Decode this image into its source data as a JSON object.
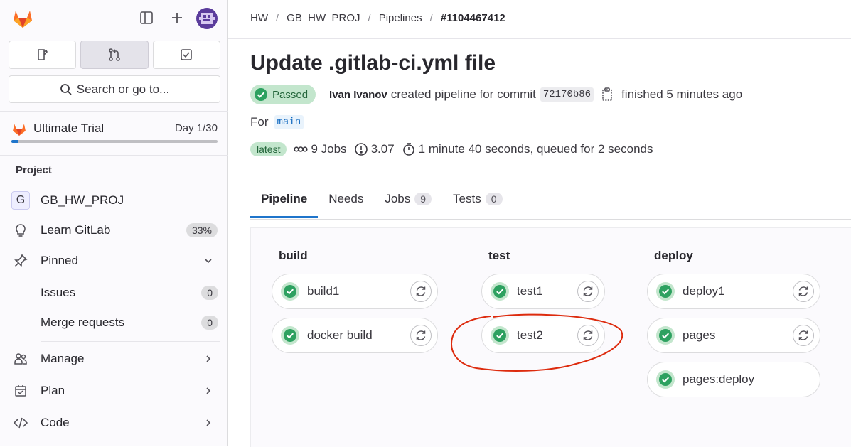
{
  "sidebar": {
    "search_label": "Search or go to...",
    "trial": {
      "label": "Ultimate Trial",
      "day": "Day 1/30",
      "progress": 0.033
    },
    "section_title": "Project",
    "project": {
      "initial": "G",
      "name": "GB_HW_PROJ"
    },
    "items": [
      {
        "label": "Learn GitLab",
        "badge": "33%"
      },
      {
        "label": "Pinned"
      },
      {
        "label": "Issues",
        "badge": "0"
      },
      {
        "label": "Merge requests",
        "badge": "0"
      },
      {
        "label": "Manage"
      },
      {
        "label": "Plan"
      },
      {
        "label": "Code"
      }
    ]
  },
  "breadcrumb": [
    "HW",
    "GB_HW_PROJ",
    "Pipelines",
    "#1104467412"
  ],
  "pipeline": {
    "title": "Update .gitlab-ci.yml file",
    "status": "Passed",
    "author": "Ivan Ivanov",
    "created_text": "created pipeline for commit",
    "commit_sha": "72170b86",
    "finished_text": "finished 5 minutes ago",
    "for_label": "For",
    "branch": "main",
    "latest_badge": "latest",
    "jobs_text": "9 Jobs",
    "ci_minutes": "3.07",
    "duration_text": "1 minute 40 seconds, queued for 2 seconds"
  },
  "tabs": [
    {
      "label": "Pipeline"
    },
    {
      "label": "Needs"
    },
    {
      "label": "Jobs",
      "count": "9"
    },
    {
      "label": "Tests",
      "count": "0"
    }
  ],
  "stages": [
    {
      "name": "build",
      "jobs": [
        "build1",
        "docker build"
      ]
    },
    {
      "name": "test",
      "jobs": [
        "test1",
        "test2"
      ]
    },
    {
      "name": "deploy",
      "jobs": [
        "deploy1",
        "pages",
        "pages:deploy"
      ]
    }
  ],
  "colors": {
    "success": "#2da160",
    "success_bg": "#c3e6cd",
    "accent": "#1f75cb",
    "annotation": "#dd2b0e"
  }
}
